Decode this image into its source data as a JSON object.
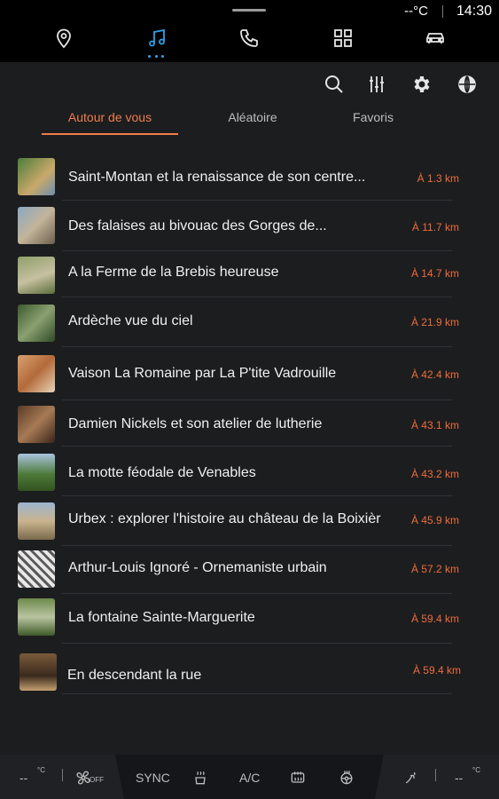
{
  "status": {
    "temperature": "--°C",
    "time": "14:30"
  },
  "nav": {
    "items": [
      {
        "icon": "location-pin-icon"
      },
      {
        "icon": "music-note-icon",
        "active": true
      },
      {
        "icon": "phone-icon"
      },
      {
        "icon": "apps-grid-icon"
      },
      {
        "icon": "car-icon"
      }
    ]
  },
  "toolbar": {
    "icons": [
      "search-icon",
      "equalizer-icon",
      "gear-icon",
      "globe-icon"
    ]
  },
  "tabs": [
    {
      "label": "Autour de vous",
      "active": true
    },
    {
      "label": "Aléatoire"
    },
    {
      "label": "Favoris"
    }
  ],
  "items": [
    {
      "title": "Saint-Montan et la renaissance de son centre...",
      "distance": "À 1.3 km"
    },
    {
      "title": "Des falaises au bivouac des Gorges de...",
      "distance": "À 11.7 km"
    },
    {
      "title": "A la Ferme de la Brebis heureuse",
      "distance": "À 14.7 km"
    },
    {
      "title": "Ardèche vue du ciel",
      "distance": "À 21.9 km"
    },
    {
      "title": "Vaison La Romaine par La P'tite Vadrouille",
      "distance": "À 42.4 km"
    },
    {
      "title": "Damien Nickels et son atelier de lutherie",
      "distance": "À 43.1 km"
    },
    {
      "title": "La motte féodale de Venables",
      "distance": "À 43.2 km"
    },
    {
      "title": "Urbex : explorer l'histoire au château de la Boixièr",
      "distance": "À 45.9 km"
    },
    {
      "title": "Arthur-Louis Ignoré - Ornemaniste urbain",
      "distance": "À 57.2 km"
    },
    {
      "title": "La fontaine Sainte-Marguerite",
      "distance": "À 59.4 km"
    },
    {
      "title": "En descendant la rue",
      "distance": "À 59.4 km"
    }
  ],
  "bottom": {
    "left_temp": "--",
    "left_unit": "°C",
    "fan_off": "OFF",
    "sync": "SYNC",
    "ac": "A/C",
    "right_temp": "--",
    "right_unit": "°C"
  },
  "colors": {
    "accent": "#f07d4a",
    "nav_active": "#2ea1e8",
    "distance": "#ec6d3c"
  }
}
